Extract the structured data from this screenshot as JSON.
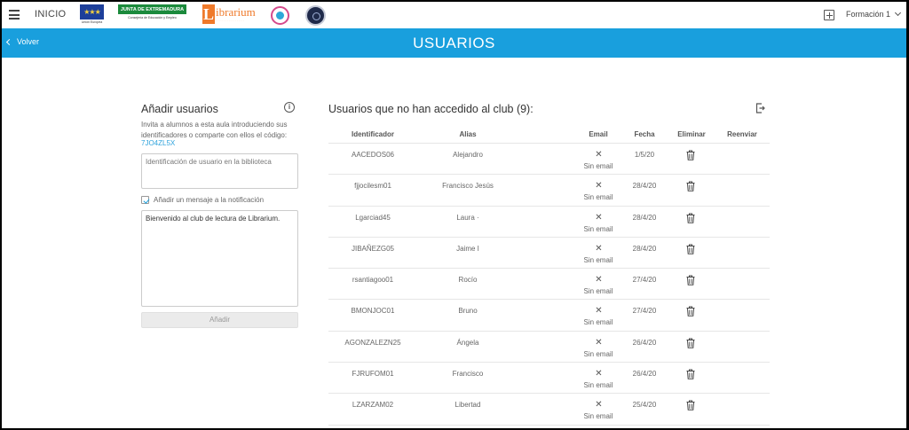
{
  "topbar": {
    "inicio": "INICIO",
    "formacion": "Formación 1",
    "logos": {
      "junta": "JUNTA DE EXTREMADURA",
      "junta_sub": "Consejería de Educación y Empleo",
      "eu_sub": "Unión Europea",
      "librarium": "ibrarium",
      "librarium_l": "L"
    }
  },
  "header": {
    "back_label": "Volver",
    "title": "USUARIOS"
  },
  "add_users": {
    "title": "Añadir usuarios",
    "invite_text": "Invita a alumnos a esta aula introduciendo sus identificadores o comparte con ellos el código:",
    "code": "7JO4ZL5X",
    "id_placeholder": "Identificación de usuario en la biblioteca",
    "checkbox_label": "Añadir un mensaje a la notificación",
    "checkbox_checked": true,
    "message": "Bienvenido al club de lectura de Librarium.",
    "add_button": "Añadir"
  },
  "users_table": {
    "title": "Usuarios que no han accedido al club (9):",
    "columns": {
      "id": "Identificador",
      "alias": "Alias",
      "email": "Email",
      "fecha": "Fecha",
      "eliminar": "Eliminar",
      "reenviar": "Reenviar"
    },
    "email_status": "Sin email",
    "rows": [
      {
        "id": "AACEDOS06",
        "alias": "Alejandro",
        "fecha": "1/5/20"
      },
      {
        "id": "fjjocilesm01",
        "alias": "Francisco Jesús",
        "fecha": "28/4/20"
      },
      {
        "id": "Lgarciad45",
        "alias": "Laura ·",
        "fecha": "28/4/20"
      },
      {
        "id": "JIBAÑEZG05",
        "alias": "Jaime I",
        "fecha": "28/4/20"
      },
      {
        "id": "rsantiagoo01",
        "alias": "Rocío",
        "fecha": "27/4/20"
      },
      {
        "id": "BMONJOC01",
        "alias": "Bruno",
        "fecha": "27/4/20"
      },
      {
        "id": "AGONZALEZN25",
        "alias": "Ángela",
        "fecha": "26/4/20"
      },
      {
        "id": "FJRUFOM01",
        "alias": "Francisco",
        "fecha": "26/4/20"
      },
      {
        "id": "LZARZAM02",
        "alias": "Libertad",
        "fecha": "25/4/20"
      }
    ]
  }
}
